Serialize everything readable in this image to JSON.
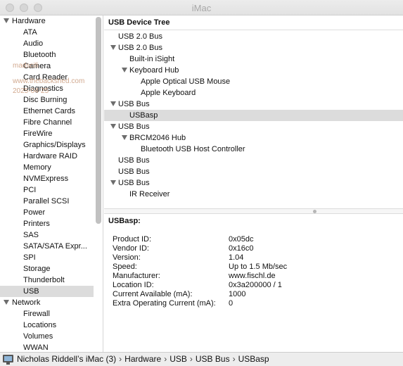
{
  "window": {
    "title": "iMac"
  },
  "watermark": {
    "name": "madscifi",
    "site": "www.thebackshed.com",
    "date": "2025-04-25"
  },
  "sidebar": {
    "groups": [
      {
        "label": "Hardware",
        "items": [
          "ATA",
          "Audio",
          "Bluetooth",
          "Camera",
          "Card Reader",
          "Diagnostics",
          "Disc Burning",
          "Ethernet Cards",
          "Fibre Channel",
          "FireWire",
          "Graphics/Displays",
          "Hardware RAID",
          "Memory",
          "NVMExpress",
          "PCI",
          "Parallel SCSI",
          "Power",
          "Printers",
          "SAS",
          "SATA/SATA Expr...",
          "SPI",
          "Storage",
          "Thunderbolt",
          "USB"
        ]
      },
      {
        "label": "Network",
        "items": [
          "Firewall",
          "Locations",
          "Volumes",
          "WWAN"
        ]
      }
    ],
    "selected": "USB"
  },
  "tree": {
    "header": "USB Device Tree",
    "rows": [
      {
        "label": "USB 2.0 Bus",
        "level": 0,
        "expanded": false
      },
      {
        "label": "USB 2.0 Bus",
        "level": 0,
        "expanded": true
      },
      {
        "label": "Built-in iSight",
        "level": 1,
        "expanded": false
      },
      {
        "label": "Keyboard Hub",
        "level": 1,
        "expanded": true
      },
      {
        "label": "Apple Optical USB Mouse",
        "level": 2,
        "expanded": false
      },
      {
        "label": "Apple Keyboard",
        "level": 2,
        "expanded": false
      },
      {
        "label": "USB Bus",
        "level": 0,
        "expanded": true
      },
      {
        "label": "USBasp",
        "level": 1,
        "expanded": false,
        "selected": true
      },
      {
        "label": "USB Bus",
        "level": 0,
        "expanded": true
      },
      {
        "label": "BRCM2046 Hub",
        "level": 1,
        "expanded": true
      },
      {
        "label": "Bluetooth USB Host Controller",
        "level": 2,
        "expanded": false
      },
      {
        "label": "USB Bus",
        "level": 0,
        "expanded": false
      },
      {
        "label": "USB Bus",
        "level": 0,
        "expanded": false
      },
      {
        "label": "USB Bus",
        "level": 0,
        "expanded": true
      },
      {
        "label": "IR Receiver",
        "level": 1,
        "expanded": false
      }
    ]
  },
  "detail": {
    "title": "USBasp:",
    "properties": [
      {
        "key": "Product ID:",
        "value": "0x05dc"
      },
      {
        "key": "Vendor ID:",
        "value": "0x16c0"
      },
      {
        "key": "Version:",
        "value": "1.04"
      },
      {
        "key": "Speed:",
        "value": "Up to 1.5 Mb/sec"
      },
      {
        "key": "Manufacturer:",
        "value": "www.fischl.de"
      },
      {
        "key": "Location ID:",
        "value": "0x3a200000 / 1"
      },
      {
        "key": "Current Available (mA):",
        "value": "1000"
      },
      {
        "key": "Extra Operating Current (mA):",
        "value": "0"
      }
    ]
  },
  "pathbar": {
    "crumbs": [
      "Nicholas Riddell’s iMac (3)",
      "Hardware",
      "USB",
      "USB Bus",
      "USBasp"
    ],
    "separator": "›"
  }
}
